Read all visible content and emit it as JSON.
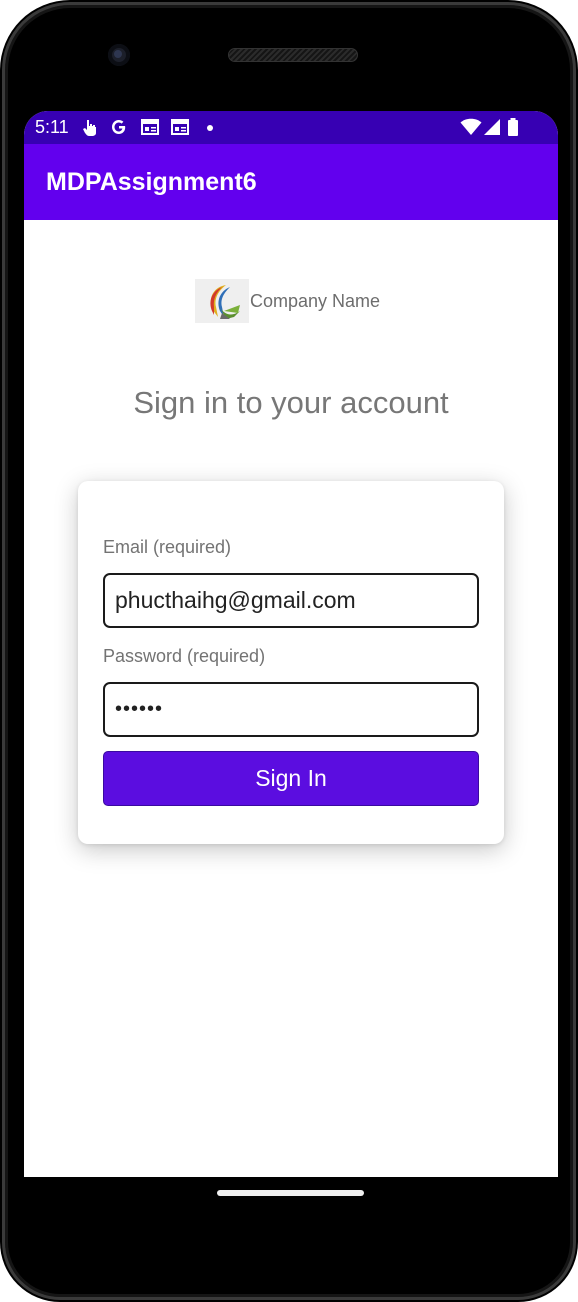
{
  "status_bar": {
    "time": "5:11",
    "icons": [
      "touch-icon",
      "google-icon",
      "news-icon",
      "news-icon",
      "notification-dot",
      "wifi-icon",
      "signal-icon",
      "battery-icon"
    ]
  },
  "app_bar": {
    "title": "MDPAssignment6",
    "color": "#6200ee",
    "status_color": "#3700b3"
  },
  "branding": {
    "company_name": "Company Name",
    "logo_icon": "company-logo"
  },
  "headline": "Sign in to your account",
  "form": {
    "email_label": "Email (required)",
    "email_value": "phucthaihg@gmail.com",
    "password_label": "Password (required)",
    "password_value": "••••••",
    "submit_label": "Sign In",
    "submit_color": "#5b0de0"
  }
}
